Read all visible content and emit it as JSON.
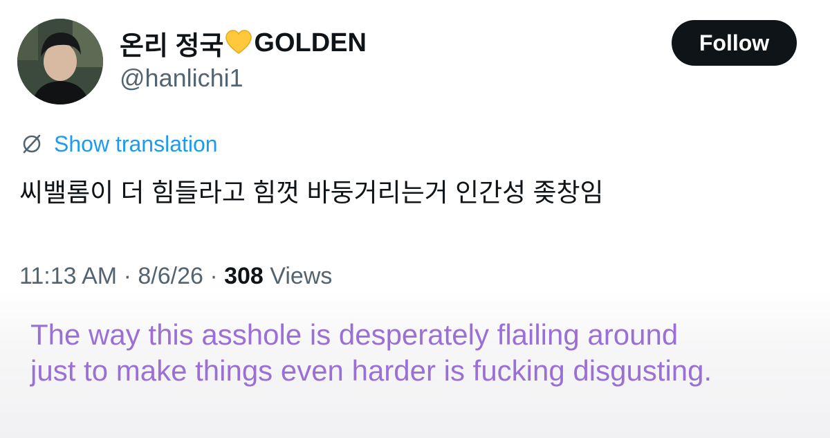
{
  "user": {
    "display_name_prefix": "온리 정국",
    "display_name_suffix": "GOLDEN",
    "heart_icon": "yellow-heart",
    "handle": "@hanlichi1",
    "avatar": "profile-photo"
  },
  "actions": {
    "follow_label": "Follow"
  },
  "translation": {
    "label": "Show translation",
    "icon": "globe-icon"
  },
  "tweet": {
    "text": "씨밸롬이 더 힘들라고 힘껏 바둥거리는거 인간성 좆창임"
  },
  "meta": {
    "time": "11:13 AM",
    "sep1": " · ",
    "date": "8/6/26",
    "sep2": " · ",
    "views_count": "308",
    "views_label": " Views"
  },
  "caption": {
    "line1": "The way this asshole is desperately flailing around",
    "line2": "just to make things even harder is fucking disgusting."
  },
  "colors": {
    "follow_bg": "#0f1419",
    "link_blue": "#1d9bf0",
    "caption_purple": "#9a6fd6",
    "muted_gray": "#536471"
  }
}
